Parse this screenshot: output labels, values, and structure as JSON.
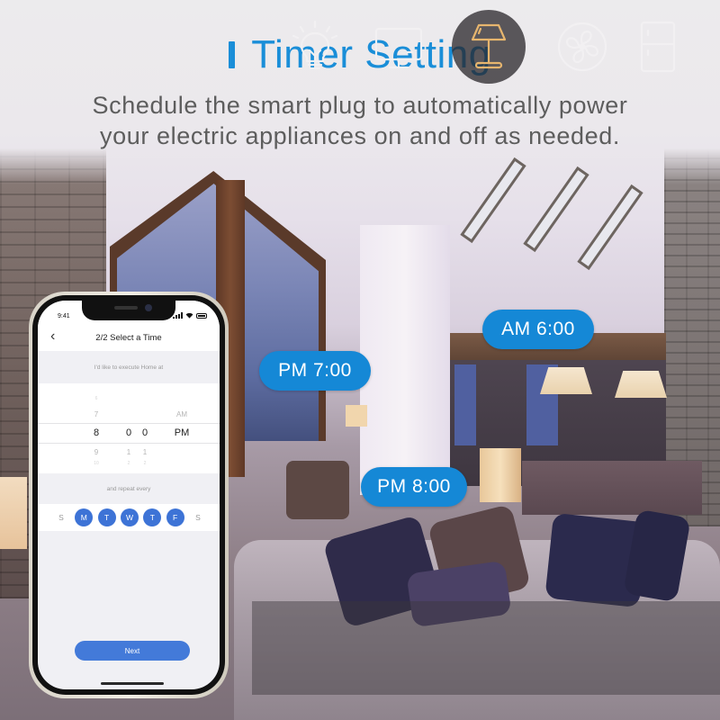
{
  "header": {
    "title": "Timer Setting",
    "subtitle_line1": "Schedule the smart plug to automatically power",
    "subtitle_line2": "your electric appliances on and off as needed."
  },
  "colors": {
    "brand_blue": "#1a8ed8",
    "pill_blue": "#1588d6",
    "app_button_blue": "#437ad9",
    "active_icon": "#e6b56e",
    "icon_stroke": "#f2f0f2"
  },
  "time_pills": [
    {
      "label": "AM 6:00"
    },
    {
      "label": "PM 7:00"
    },
    {
      "label": "PM 8:00"
    }
  ],
  "phone": {
    "status_time": "9:41",
    "status_icons": [
      "signal-icon",
      "wifi-icon",
      "battery-icon"
    ],
    "nav": {
      "back_icon": "chevron-left-icon",
      "back_glyph": "‹",
      "title": "2/2 Select a Time"
    },
    "prompt": "I'd like to execute Home at",
    "picker": {
      "hour": {
        "above2": "6",
        "above": "7",
        "selected": "8",
        "below": "9",
        "below2": "10"
      },
      "minute_tens": {
        "above2": "",
        "above": "",
        "selected": "0",
        "below": "1",
        "below2": "2"
      },
      "minute_ones": {
        "above2": "",
        "above": "",
        "selected": "0",
        "below": "1",
        "below2": "2"
      },
      "period": {
        "above": "AM",
        "selected": "PM"
      }
    },
    "repeat_label": "and repeat every",
    "days": [
      {
        "label": "S",
        "selected": false
      },
      {
        "label": "M",
        "selected": true
      },
      {
        "label": "T",
        "selected": true
      },
      {
        "label": "W",
        "selected": true
      },
      {
        "label": "T",
        "selected": true
      },
      {
        "label": "F",
        "selected": true
      },
      {
        "label": "S",
        "selected": false
      }
    ],
    "next_label": "Next"
  },
  "appliances": [
    {
      "name": "light-bulb",
      "active": false
    },
    {
      "name": "monitor",
      "active": false
    },
    {
      "name": "table-lamp",
      "active": true
    },
    {
      "name": "fan",
      "active": false
    },
    {
      "name": "refrigerator",
      "active": false
    }
  ]
}
